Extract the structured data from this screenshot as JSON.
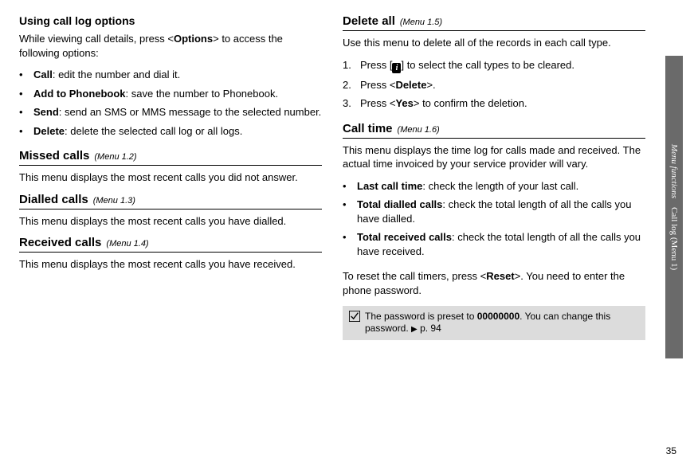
{
  "left": {
    "sub_heading": "Using call log options",
    "intro_a": "While viewing call details, press <",
    "intro_b": "Options",
    "intro_c": "> to access the following options:",
    "opts": [
      {
        "label": "Call",
        "desc": ": edit the number and dial it."
      },
      {
        "label": "Add to Phonebook",
        "desc": ": save the number to Phonebook."
      },
      {
        "label": "Send",
        "desc": ": send an SMS or MMS message to the selected number."
      },
      {
        "label": "Delete",
        "desc": ": delete the selected call log or all logs."
      }
    ],
    "missed_h": "Missed calls",
    "missed_ref": "(Menu 1.2)",
    "missed_p": "This menu displays the most recent calls you did not answer.",
    "dialled_h": "Dialled calls",
    "dialled_ref": "(Menu 1.3)",
    "dialled_p": "This menu displays the most recent calls you have dialled.",
    "received_h": "Received calls",
    "received_ref": "(Menu 1.4)",
    "received_p": "This menu displays the most recent calls you have received."
  },
  "right": {
    "deleteall_h": "Delete all",
    "deleteall_ref": "(Menu 1.5)",
    "deleteall_p": "Use this menu to delete all of the records in each call type.",
    "steps": [
      {
        "n": "1.",
        "pre": "Press [",
        "post": "] to select the call types to be cleared."
      },
      {
        "n": "2.",
        "pre": "Press <",
        "b": "Delete",
        "post": ">."
      },
      {
        "n": "3.",
        "pre": "Press <",
        "b": "Yes",
        "post": "> to confirm the deletion."
      }
    ],
    "calltime_h": "Call time",
    "calltime_ref": "(Menu 1.6)",
    "calltime_p": "This menu displays the time log for calls made and received. The actual time invoiced by your service provider will vary.",
    "ctopts": [
      {
        "label": "Last call time",
        "desc": ": check the length of your last call."
      },
      {
        "label": "Total dialled calls",
        "desc": ": check the total length of all the calls you have dialled."
      },
      {
        "label": "Total received calls",
        "desc": ": check the total length of all the calls you have received."
      }
    ],
    "reset_a": "To reset the call timers, press <",
    "reset_b": "Reset",
    "reset_c": ">. You need to enter the phone password.",
    "note_a": "The password is preset to ",
    "note_b": "00000000",
    "note_c": ". You can change this password.",
    "note_ref": "p. 94"
  },
  "side": {
    "a": "Menu functions",
    "b": "Call log (Menu 1)"
  },
  "page_num": "35",
  "bullet": "•",
  "info_char": "i",
  "arrow": "▶"
}
